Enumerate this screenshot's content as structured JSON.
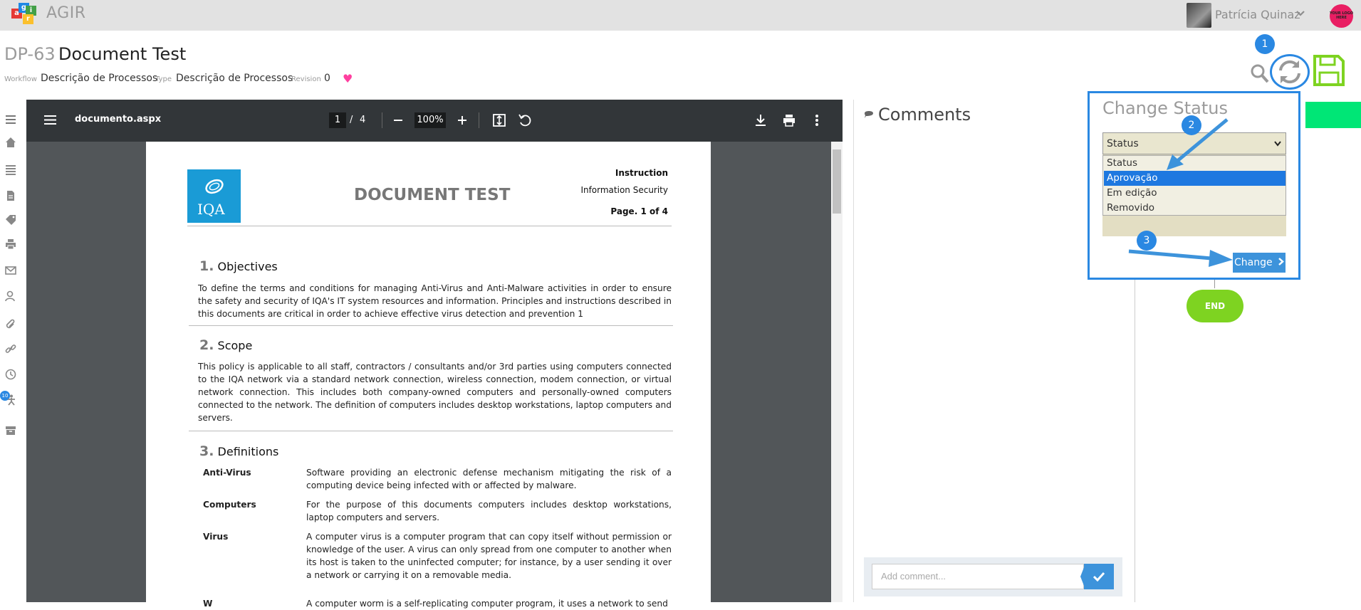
{
  "app": {
    "name": "AGIR",
    "logo_letters": [
      "a",
      "g",
      "i",
      "r"
    ]
  },
  "user": {
    "name": "Patrícia Quinaz",
    "logo_text": "YOUR LOGO HERE"
  },
  "header": {
    "doc_id": "DP-63",
    "doc_title": "Document Test",
    "workflow_label": "Workflow",
    "workflow_value": "Descrição de Processos",
    "type_label": "Type",
    "type_value": "Descrição de Processos",
    "revision_label": "Revision",
    "revision_value": "0"
  },
  "pdf_viewer": {
    "filename": "documento.aspx",
    "page_current": "1",
    "page_sep": "/",
    "page_total": "4",
    "zoom": "100%"
  },
  "document": {
    "logo_text": "IQA",
    "title": "DOCUMENT TEST",
    "doc_type": "Instruction",
    "category": "Information Security",
    "page_prefix": "Page.",
    "page_num": "1",
    "page_of": "of",
    "page_total": "4",
    "sections": [
      {
        "num": "1.",
        "title": "Objectives",
        "text": "To define the terms and conditions for managing Anti-Virus and Anti-Malware activities in order to ensure the safety and security of IQA's IT system resources and information. Principles and instructions described in this documents are critical in order to achieve effective virus detection and prevention 1"
      },
      {
        "num": "2.",
        "title": "Scope",
        "text": "This policy is applicable to all staff, contractors / consultants and/or 3rd parties using computers connected to the IQA network via a standard network connection, wireless connection, modem connection, or virtual network connection. This includes both company-owned computers and personally-owned computers connected to the network. The definition of computers includes desktop workstations, laptop computers and servers."
      },
      {
        "num": "3.",
        "title": "Definitions"
      }
    ],
    "definitions": [
      {
        "term": "Anti-Virus",
        "text": "Software providing an electronic defense mechanism mitigating the risk of a computing device being infected with or affected by malware."
      },
      {
        "term": "Computers",
        "text": "For the purpose of this documents computers includes desktop workstations, laptop computers and servers."
      },
      {
        "term": "Virus",
        "text": "A computer virus is a computer program that can copy itself without permission or knowledge of the user. A virus can only spread from one computer to another when its host is taken to the uninfected computer; for instance, by a user sending it over a network or carrying it on a removable media."
      },
      {
        "term": "W",
        "text": "A computer worm is a self-replicating computer program, it uses a network to send"
      }
    ]
  },
  "comments": {
    "title": "Comments",
    "placeholder": "Add comment..."
  },
  "sidebar": {
    "badge": "10"
  },
  "status_popup": {
    "title": "Change Status",
    "selected": "Status",
    "options": [
      "Status",
      "Aprovação",
      "Em edição",
      "Removido"
    ],
    "highlighted_index": 1,
    "change_label": "Change",
    "callouts": [
      "1",
      "2",
      "3"
    ]
  },
  "workflow": {
    "end_label": "END"
  },
  "colors": {
    "accent": "#2a88e2",
    "button": "#3d93db",
    "end_node": "#7ed321",
    "save": "#7ed321",
    "heart": "#ff3f9f",
    "highlight": "#2a88e2"
  }
}
